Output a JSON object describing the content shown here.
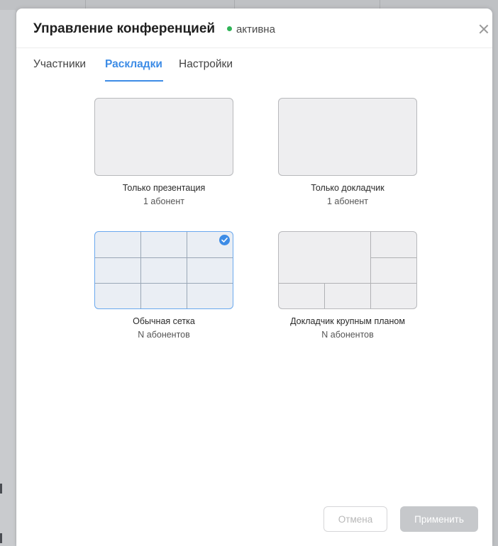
{
  "header": {
    "title": "Управление конференцией",
    "status_label": "активна"
  },
  "tabs": [
    {
      "label": "Участники",
      "active": false
    },
    {
      "label": "Раскладки",
      "active": true
    },
    {
      "label": "Настройки",
      "active": false
    }
  ],
  "layouts": [
    {
      "name": "Только презентация",
      "count": "1 абонент",
      "selected": false
    },
    {
      "name": "Только докладчик",
      "count": "1 абонент",
      "selected": false
    },
    {
      "name": "Обычная сетка",
      "count": "N абонентов",
      "selected": true
    },
    {
      "name": "Докладчик крупным планом",
      "count": "N абонентов",
      "selected": false
    }
  ],
  "footer": {
    "cancel_label": "Отмена",
    "apply_label": "Применить"
  },
  "colors": {
    "accent": "#3d8ce6",
    "status_active": "#2fb457",
    "disabled_button": "#c6c8cb"
  },
  "icons": [
    "close-icon",
    "checkmark-icon",
    "status-dot-icon"
  ]
}
